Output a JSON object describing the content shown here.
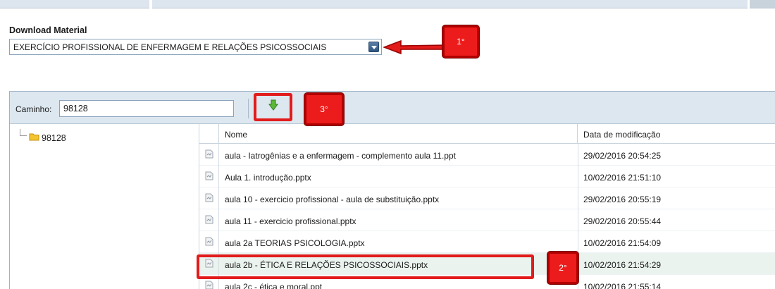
{
  "download": {
    "label": "Download Material",
    "selected_course": "EXERCÍCIO PROFISSIONAL DE ENFERMAGEM E RELAÇÕES PSICOSSOCIAIS"
  },
  "toolbar": {
    "path_label": "Caminho:",
    "path_value": "98128"
  },
  "tree": {
    "root_label": "98128"
  },
  "grid": {
    "columns": {
      "name": "Nome",
      "date": "Data de modificação"
    },
    "rows": [
      {
        "name": "aula - Iatrogênias e a enfermagem - complemento aula 11.ppt",
        "date": "29/02/2016 20:54:25"
      },
      {
        "name": "Aula 1. introdução.pptx",
        "date": "10/02/2016 21:51:10"
      },
      {
        "name": "aula 10 - exercicio profissional - aula de substituição.pptx",
        "date": "29/02/2016 20:55:19"
      },
      {
        "name": "aula 11 - exercicio profissional.pptx",
        "date": "29/02/2016 20:55:44"
      },
      {
        "name": "aula 2a TEORIAS PSICOLOGIA.pptx",
        "date": "10/02/2016 21:54:09"
      },
      {
        "name": "aula 2b - ÉTICA E RELAÇÕES PSICOSSOCIAIS.pptx",
        "date": "10/02/2016 21:54:29"
      },
      {
        "name": "aula 2c - ética e moral.ppt",
        "date": "10/02/2016 21:55:14"
      }
    ]
  },
  "annotations": {
    "step1": "1°",
    "step2": "2°",
    "step3": "3°"
  },
  "colors": {
    "annotation_red": "#e21b1b",
    "toolbar_bg": "#dde7ef",
    "download_green": "#5cb83a"
  },
  "icons": {
    "download_button": "green-down-arrow-icon",
    "tree_folder": "folder-icon",
    "file": "file-icon",
    "select_arrow": "chevron-down-icon"
  }
}
